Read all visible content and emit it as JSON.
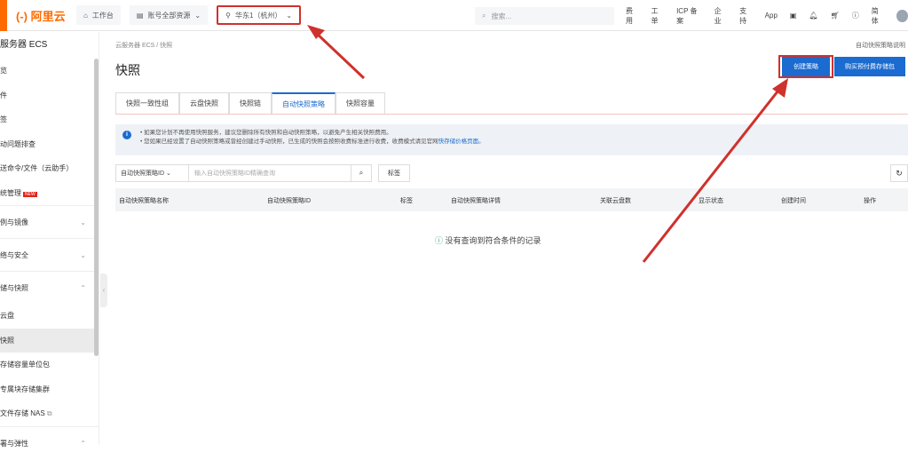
{
  "topbar": {
    "logo": "(-) 阿里云",
    "workbench": "工作台",
    "account": "账号全部资源",
    "region": "华东1（杭州）",
    "search_placeholder": "搜索...",
    "nav": [
      "费用",
      "工单",
      "ICP 备案",
      "企业",
      "支持",
      "App"
    ],
    "lang": "简体"
  },
  "sidebar": {
    "title": "服务器 ECS",
    "items": [
      {
        "label": "览"
      },
      {
        "label": "件"
      },
      {
        "label": "签"
      },
      {
        "label": "动问题排查"
      },
      {
        "label": "送命令/文件（云助手）"
      },
      {
        "label": "统管理",
        "badge": "NEW"
      }
    ],
    "groups": [
      {
        "label": "例与镜像",
        "expanded": false
      },
      {
        "label": "络与安全",
        "expanded": false
      },
      {
        "label": "储与快照",
        "expanded": true,
        "children": [
          "云盘",
          "快照",
          "存储容量单位包",
          "专属块存储集群",
          "文件存储 NAS"
        ]
      },
      {
        "label": "署与弹性",
        "expanded": true
      }
    ]
  },
  "main": {
    "breadcrumb": "云服务器 ECS / 快照",
    "help": "自动快照策略说明",
    "title": "快照",
    "create_btn": "创建策略",
    "buy_btn": "购买预付费存储包",
    "tabs": [
      "快照一致性组",
      "云盘快照",
      "快照链",
      "自动快照策略",
      "快照容量"
    ],
    "active_tab": 3,
    "notice": [
      "如果您计划不再使用快照服务，建议您删除所有快照和自动快照策略，以避免产生相关快照费用。",
      "您如果已经设置了自动快照策略或曾经创建过手动快照，已生成的快照会按照收费标准进行收费，收费模式请见官网"
    ],
    "notice_link": "快存储价格页面。",
    "filter_select": "自动快照策略ID",
    "search_placeholder": "输入自动快照策略ID精确查询",
    "tag_btn": "标签",
    "columns": [
      "自动快照策略名称",
      "自动快照策略ID",
      "标签",
      "自动快照策略详情",
      "关联云盘数",
      "显示状态",
      "创建时间",
      "操作"
    ],
    "empty": "没有查询到符合条件的记录"
  },
  "colors": {
    "accent": "#1b6bd0",
    "brand": "#ff6a00",
    "annotation": "#d0312d"
  }
}
